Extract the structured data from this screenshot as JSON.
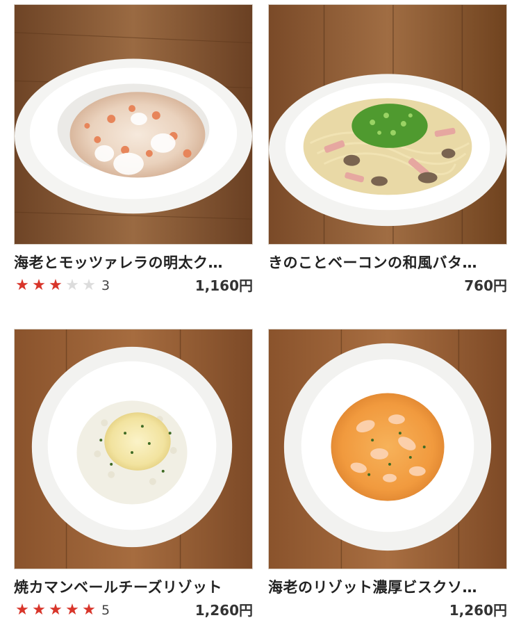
{
  "menu": {
    "items": [
      {
        "name": "海老とモッツァレラの明太ク…",
        "rating": 3,
        "rating_count": "3",
        "price": "1,160円",
        "image": "shrimp-mozzarella-mentaiko-cream-pasta-photo"
      },
      {
        "name": "きのことベーコンの和風バタ…",
        "rating": null,
        "rating_count": "",
        "price": "760円",
        "image": "mushroom-bacon-butter-pasta-photo"
      },
      {
        "name": "焼カマンベールチーズリゾット",
        "rating": 5,
        "rating_count": "5",
        "price": "1,260円",
        "image": "baked-camembert-risotto-photo"
      },
      {
        "name": "海老のリゾット濃厚ビスクソ…",
        "rating": null,
        "rating_count": "",
        "price": "1,260円",
        "image": "shrimp-bisque-risotto-photo"
      }
    ]
  },
  "colors": {
    "star_on": "#d8352a",
    "star_off": "#dcdcdc",
    "wood": "#8a5a36"
  }
}
